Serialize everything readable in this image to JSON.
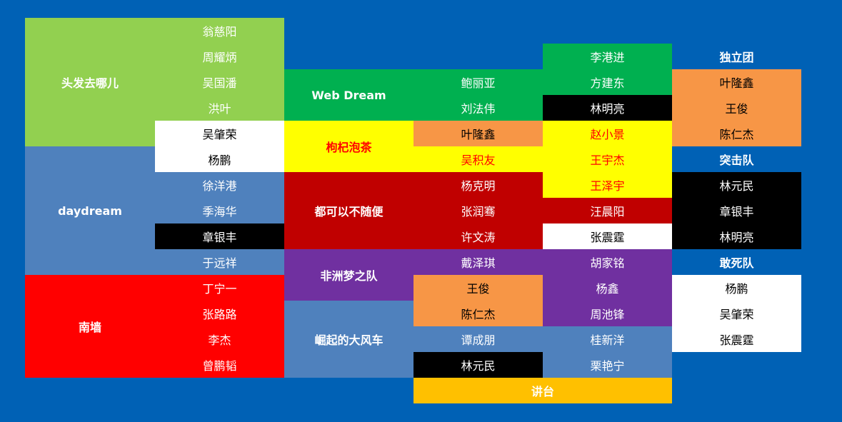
{
  "colors": {
    "page_background": "#0061B5",
    "light_green": "#92D050",
    "steel_blue": "#4F81BD",
    "red": "#FF0000",
    "green": "#00B050",
    "yellow": "#FFFF00",
    "dark_red": "#C00000",
    "purple": "#7030A0",
    "orange": "#F79646",
    "black": "#000000",
    "white": "#FFFFFF",
    "gold": "#FFC000"
  },
  "teams": {
    "toufa": {
      "name": "头发去哪儿",
      "members": [
        "翁慈阳",
        "周耀炳",
        "吴国潘",
        "洪叶",
        "吴肇荣",
        "杨鹏"
      ]
    },
    "daydream": {
      "name": "daydream",
      "members": [
        "徐洋港",
        "季海华",
        "章银丰",
        "于远祥"
      ]
    },
    "nanqiang": {
      "name": "南墙",
      "members": [
        "丁宁一",
        "张路路",
        "李杰",
        "曾鹏韬"
      ]
    },
    "webdream": {
      "name": "Web Dream",
      "members": [
        "李港进",
        "鲍丽亚",
        "方建东",
        "刘法伟",
        "林明亮"
      ]
    },
    "gouqi": {
      "name": "枸杞泡茶",
      "members": [
        "叶隆鑫",
        "赵小景",
        "吴积友",
        "王宇杰",
        "王泽宇"
      ]
    },
    "suibian": {
      "name": "都可以不随便",
      "members": [
        "杨克明",
        "张润骞",
        "汪晨阳",
        "许文涛",
        "张震霆"
      ]
    },
    "feizhou": {
      "name": "非洲梦之队",
      "members": [
        "戴泽琪",
        "胡家铭",
        "王俊",
        "杨鑫",
        "陈仁杰",
        "周池锋"
      ]
    },
    "fengche": {
      "name": "崛起的大风车",
      "members": [
        "谭成朋",
        "桂新洋",
        "林元民",
        "栗艳宁"
      ]
    },
    "duli": {
      "name": "独立团",
      "members": [
        "叶隆鑫",
        "王俊",
        "陈仁杰"
      ]
    },
    "tuji": {
      "name": "突击队",
      "members": [
        "林元民",
        "章银丰",
        "林明亮"
      ]
    },
    "gansi": {
      "name": "敢死队",
      "members": [
        "杨鹏",
        "吴肇荣",
        "张震霆"
      ]
    }
  },
  "podium": {
    "label": "讲台"
  }
}
